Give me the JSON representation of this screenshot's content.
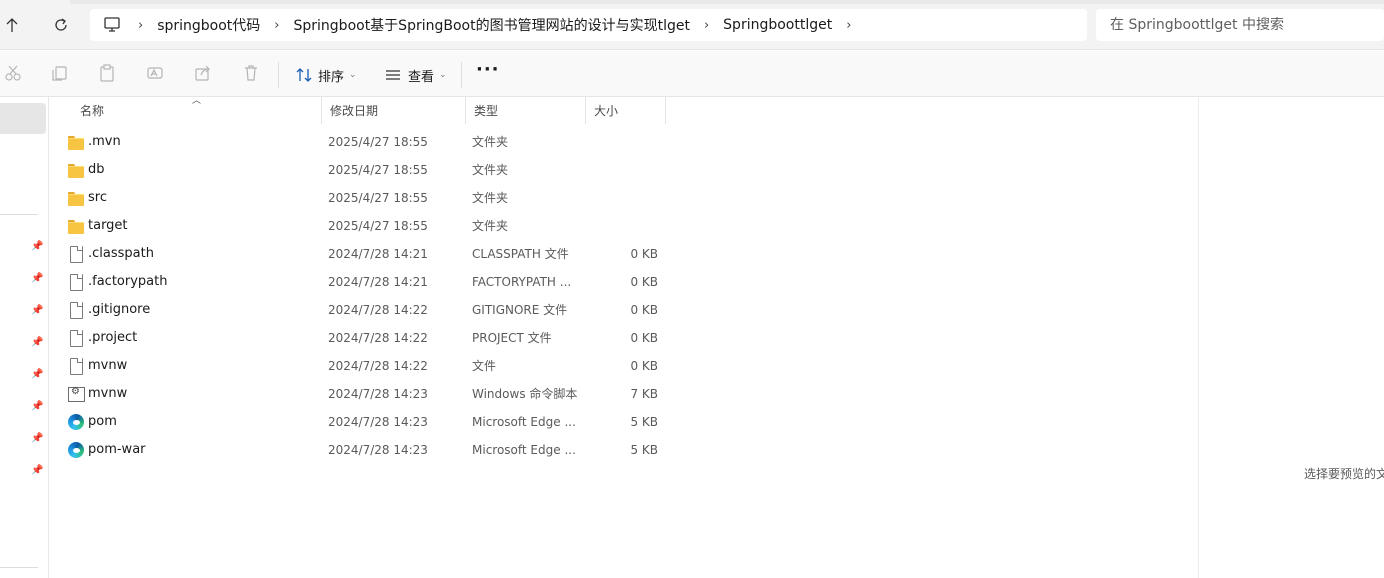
{
  "address": {
    "path": [
      "springboot代码",
      "Springboot基于SpringBoot的图书管理网站的设计与实现tlget",
      "Springboottlget"
    ],
    "separator": "›"
  },
  "search": {
    "placeholder": "在 Springboottlget 中搜索"
  },
  "toolbar": {
    "sort_label": "排序",
    "view_label": "查看",
    "more_label": "···",
    "icons": [
      "cut-icon",
      "copy-icon",
      "paste-icon",
      "rename-icon",
      "share-icon",
      "delete-icon"
    ]
  },
  "columns": {
    "name": "名称",
    "date": "修改日期",
    "type": "类型",
    "size": "大小"
  },
  "files": [
    {
      "icon": "folder-icon",
      "name": ".mvn",
      "date": "2025/4/27 18:55",
      "type": "文件夹",
      "size": ""
    },
    {
      "icon": "folder-icon",
      "name": "db",
      "date": "2025/4/27 18:55",
      "type": "文件夹",
      "size": ""
    },
    {
      "icon": "folder-icon",
      "name": "src",
      "date": "2025/4/27 18:55",
      "type": "文件夹",
      "size": ""
    },
    {
      "icon": "folder-icon",
      "name": "target",
      "date": "2025/4/27 18:55",
      "type": "文件夹",
      "size": ""
    },
    {
      "icon": "file-icon",
      "name": ".classpath",
      "date": "2024/7/28 14:21",
      "type": "CLASSPATH 文件",
      "size": "0 KB"
    },
    {
      "icon": "file-icon",
      "name": ".factorypath",
      "date": "2024/7/28 14:21",
      "type": "FACTORYPATH ...",
      "size": "0 KB"
    },
    {
      "icon": "file-icon",
      "name": ".gitignore",
      "date": "2024/7/28 14:22",
      "type": "GITIGNORE 文件",
      "size": "0 KB"
    },
    {
      "icon": "file-icon",
      "name": ".project",
      "date": "2024/7/28 14:22",
      "type": "PROJECT 文件",
      "size": "0 KB"
    },
    {
      "icon": "file-icon",
      "name": "mvnw",
      "date": "2024/7/28 14:22",
      "type": "文件",
      "size": "0 KB"
    },
    {
      "icon": "script-icon",
      "name": "mvnw",
      "date": "2024/7/28 14:23",
      "type": "Windows 命令脚本",
      "size": "7 KB"
    },
    {
      "icon": "edge-icon",
      "name": "pom",
      "date": "2024/7/28 14:23",
      "type": "Microsoft Edge ...",
      "size": "5 KB"
    },
    {
      "icon": "edge-icon",
      "name": "pom-war",
      "date": "2024/7/28 14:23",
      "type": "Microsoft Edge ...",
      "size": "5 KB"
    }
  ],
  "preview": {
    "text": "选择要预览的文"
  }
}
